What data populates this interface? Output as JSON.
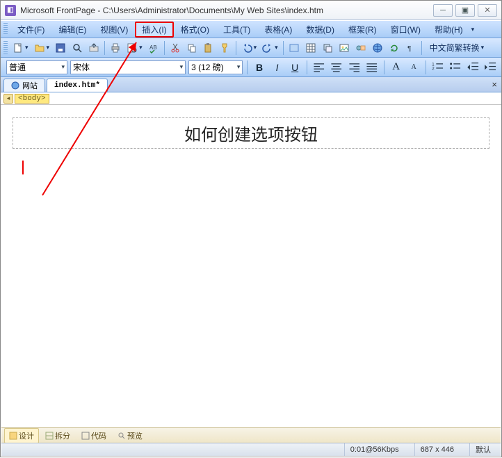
{
  "window": {
    "app_name": "Microsoft FrontPage",
    "title_path": "C:\\Users\\Administrator\\Documents\\My Web Sites\\index.htm"
  },
  "menu": {
    "file": "文件(F)",
    "edit": "编辑(E)",
    "view": "视图(V)",
    "insert": "插入(I)",
    "format": "格式(O)",
    "tools": "工具(T)",
    "table": "表格(A)",
    "data": "数据(D)",
    "frames": "框架(R)",
    "window": "窗口(W)",
    "help": "帮助(H)"
  },
  "toolbar_extra": {
    "convert_label": "中文简繁转换"
  },
  "format_bar": {
    "style": "普通",
    "font": "宋体",
    "size": "3 (12 磅)"
  },
  "tabs": {
    "site": "网站",
    "file": "index.htm*"
  },
  "breadcrumb": {
    "body_tag": "<body>"
  },
  "document": {
    "heading": "如何创建选项按钮"
  },
  "view_tabs": {
    "design": "设计",
    "split": "拆分",
    "code": "代码",
    "preview": "预览"
  },
  "status": {
    "time_rate": "0:01@56Kbps",
    "dimensions": "687 x 446",
    "mode": "默认"
  },
  "annotation": {
    "highlighted_menu": "insert"
  }
}
